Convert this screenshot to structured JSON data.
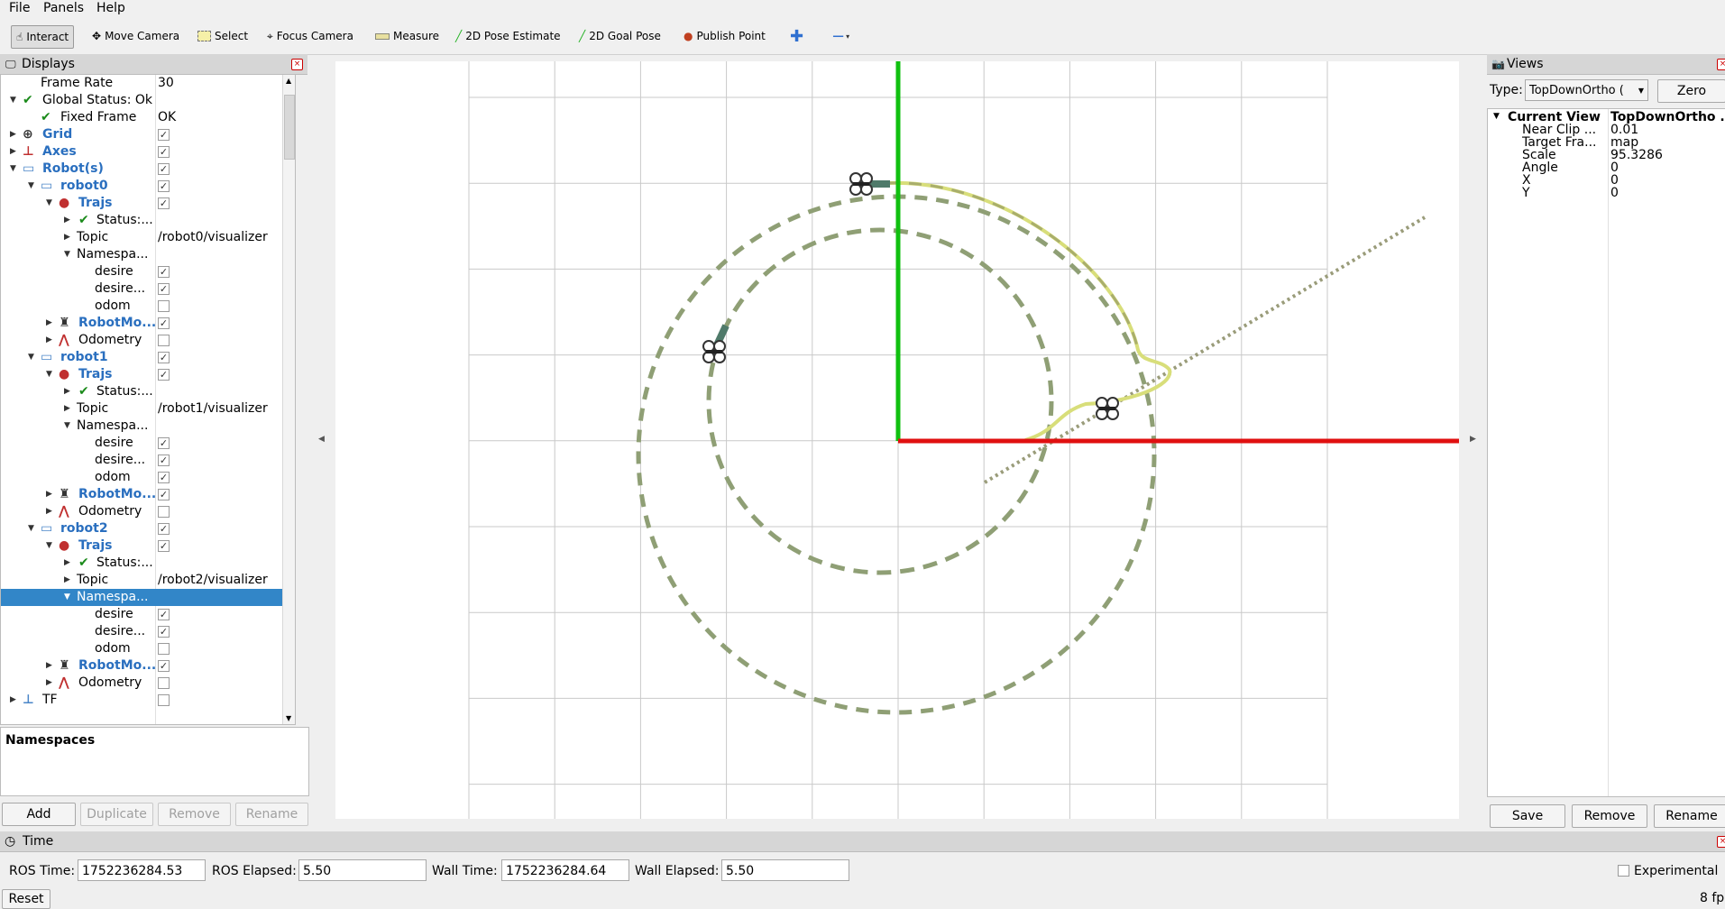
{
  "menu": {
    "file": "File",
    "panels": "Panels",
    "help": "Help"
  },
  "toolbar": {
    "interact": "Interact",
    "move_camera": "Move Camera",
    "select": "Select",
    "focus_camera": "Focus Camera",
    "measure": "Measure",
    "pose_estimate": "2D Pose Estimate",
    "goal_pose": "2D Goal Pose",
    "publish_point": "Publish Point"
  },
  "displays": {
    "title": "Displays",
    "rows": [
      {
        "label": "Frame Rate",
        "value": "30"
      },
      {
        "label": "Global Status: Ok"
      },
      {
        "label": "Fixed Frame",
        "value": "OK"
      },
      {
        "label": "Grid"
      },
      {
        "label": "Axes"
      },
      {
        "label": "Robot(s)"
      },
      {
        "label": "robot0"
      },
      {
        "label": "Trajs"
      },
      {
        "label": "Status:..."
      },
      {
        "label": "Topic",
        "value": "/robot0/visualizer"
      },
      {
        "label": "Namespa..."
      },
      {
        "label": "desire"
      },
      {
        "label": "desire..."
      },
      {
        "label": "odom"
      },
      {
        "label": "RobotMo..."
      },
      {
        "label": "Odometry"
      },
      {
        "label": "robot1"
      },
      {
        "label": "Trajs"
      },
      {
        "label": "Status:..."
      },
      {
        "label": "Topic",
        "value": "/robot1/visualizer"
      },
      {
        "label": "Namespa..."
      },
      {
        "label": "desire"
      },
      {
        "label": "desire..."
      },
      {
        "label": "odom"
      },
      {
        "label": "RobotMo..."
      },
      {
        "label": "Odometry"
      },
      {
        "label": "robot2"
      },
      {
        "label": "Trajs"
      },
      {
        "label": "Status:..."
      },
      {
        "label": "Topic",
        "value": "/robot2/visualizer"
      },
      {
        "label": "Namespa..."
      },
      {
        "label": "desire"
      },
      {
        "label": "desire..."
      },
      {
        "label": "odom"
      },
      {
        "label": "RobotMo..."
      },
      {
        "label": "Odometry"
      },
      {
        "label": "TF"
      }
    ],
    "description_title": "Namespaces",
    "buttons": {
      "add": "Add",
      "duplicate": "Duplicate",
      "remove": "Remove",
      "rename": "Rename"
    }
  },
  "views": {
    "title": "Views",
    "type_label": "Type:",
    "type_value": "TopDownOrtho (",
    "zero_button": "Zero",
    "current_view_label": "Current View",
    "current_view_value": "TopDownOrtho ...",
    "props": [
      {
        "label": "Near Clip ...",
        "value": "0.01"
      },
      {
        "label": "Target Fra...",
        "value": "map"
      },
      {
        "label": "Scale",
        "value": "95.3286"
      },
      {
        "label": "Angle",
        "value": "0"
      },
      {
        "label": "X",
        "value": "0"
      },
      {
        "label": "Y",
        "value": "0"
      }
    ],
    "buttons": {
      "save": "Save",
      "remove": "Remove",
      "rename": "Rename"
    }
  },
  "time": {
    "title": "Time",
    "ros_time_label": "ROS Time:",
    "ros_time": "1752236284.53",
    "ros_elapsed_label": "ROS Elapsed:",
    "ros_elapsed": "5.50",
    "wall_time_label": "Wall Time:",
    "wall_time": "1752236284.64",
    "wall_elapsed_label": "Wall Elapsed:",
    "wall_elapsed": "5.50",
    "experimental_label": "Experimental",
    "reset_button": "Reset",
    "fps": "8 fp"
  },
  "colors": {
    "x_axis": "#e01010",
    "y_axis": "#10c010",
    "traj_dashed": "#8f9f75",
    "traj_odom": "#d8de7a"
  }
}
